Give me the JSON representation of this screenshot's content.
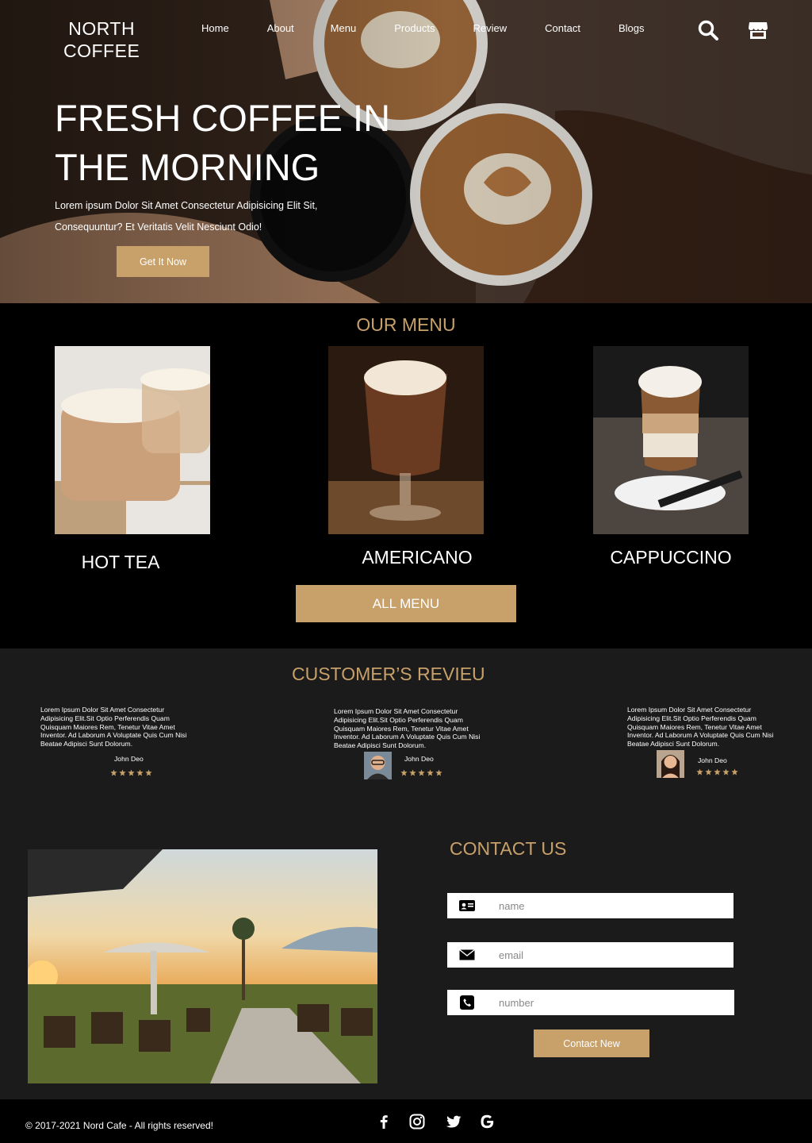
{
  "header": {
    "logo_line1": "NORTH",
    "logo_line2": "COFFEE",
    "nav": [
      "Home",
      "About",
      "Menu",
      "Products",
      "Review",
      "Contact",
      "Blogs"
    ],
    "search_icon": "search-icon",
    "store_icon": "store-icon"
  },
  "hero": {
    "title_line1": "FRESH COFFEE IN",
    "title_line2": "THE MORNING",
    "text_line1": "Lorem ipsum Dolor Sit Amet Consectetur Adipisicing Elit Sit,",
    "text_line2": "Consequuntur? Et Veritatis Velit Nesciunt Odio!",
    "button": "Get It Now"
  },
  "menu": {
    "title": "OUR MENU",
    "items": [
      {
        "name": "HOT TEA"
      },
      {
        "name": "AMERICANO"
      },
      {
        "name": "CAPPUCCINO"
      }
    ],
    "button": "ALL MENU"
  },
  "reviews": {
    "title": "CUSTOMER’S REVIEU",
    "items": [
      {
        "text": "Lorem Ipsum Dolor Sit Amet Consectetur Adipisicing Elit.Sit Optio Perferendis Quam Quisquam Maiores Rem, Tenetur Vitae Amet Inventor. Ad Laborum A Voluptate Quis Cum Nisi Beatae Adipisci Sunt Dolorum.",
        "name": "John Deo",
        "rating": 5
      },
      {
        "text": "Lorem Ipsum Dolor Sit Amet Consectetur Adipisicing Elit.Sit Optio Perferendis Quam Quisquam Maiores Rem, Tenetur Vitae Amet Inventor. Ad Laborum A Voluptate Quis Cum Nisi Beatae Adipisci Sunt Dolorum.",
        "name": "John Deo",
        "rating": 5
      },
      {
        "text": "Lorem Ipsum Dolor Sit Amet Consectetur Adipisicing Elit.Sit Optio Perferendis Quam Quisquam Maiores Rem, Tenetur Vitae Amet Inventor. Ad Laborum A Voluptate Quis Cum Nisi Beatae Adipisci Sunt Dolorum.",
        "name": "John Deo",
        "rating": 5
      }
    ]
  },
  "contact": {
    "title": "CONTACT US",
    "name_placeholder": "name",
    "email_placeholder": "email",
    "number_placeholder": "number",
    "button": "Contact New"
  },
  "footer": {
    "copyright": "© 2017-2021 Nord Cafe - All rights reserved!",
    "social": [
      "facebook-icon",
      "instagram-icon",
      "twitter-icon",
      "google-icon"
    ]
  },
  "colors": {
    "accent": "#c8a06a",
    "dark_bg": "#1b1b1b",
    "black": "#000000"
  }
}
